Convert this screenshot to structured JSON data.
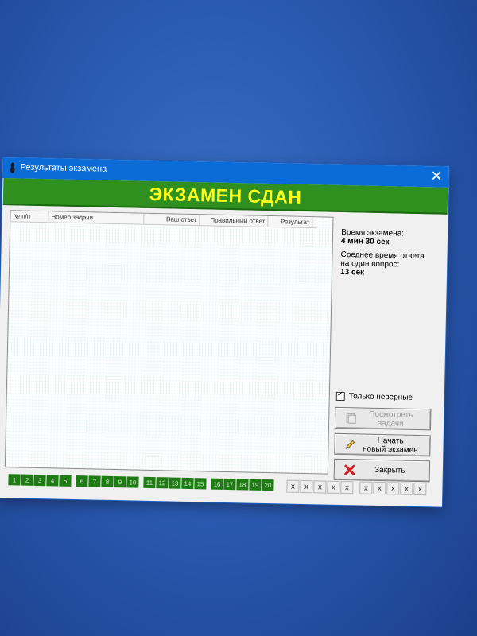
{
  "window": {
    "title": "Результаты экзамена"
  },
  "banner": {
    "text": "ЭКЗАМЕН СДАН"
  },
  "table": {
    "columns": [
      "№ п/п",
      "Номер задачи",
      "Ваш ответ",
      "Правильный ответ",
      "Результат"
    ]
  },
  "info": {
    "exam_time_label": "Время экзамена:",
    "exam_time_value": "4 мин 30 сек",
    "avg_label_line1": "Среднее время ответа",
    "avg_label_line2": "на один вопрос:",
    "avg_value": "13 сек"
  },
  "filter": {
    "only_wrong_label": "Только неверные",
    "checked": true
  },
  "buttons": {
    "view_tasks_line1": "Посмотреть",
    "view_tasks_line2": "задачи",
    "new_exam_line1": "Начать",
    "new_exam_line2": "новый экзамен",
    "close_label": "Закрыть"
  },
  "questions": [
    "1",
    "2",
    "3",
    "4",
    "5",
    "6",
    "7",
    "8",
    "9",
    "10",
    "11",
    "12",
    "13",
    "14",
    "15",
    "16",
    "17",
    "18",
    "19",
    "20"
  ],
  "extra_markers": [
    "x",
    "x",
    "x",
    "x",
    "x",
    "x",
    "x",
    "x",
    "x",
    "x"
  ],
  "colors": {
    "banner_bg": "#2f8f1f",
    "banner_text": "#fbff1a",
    "question_green": "#1f7c14",
    "titlebar": "#0b6cd8"
  },
  "icons": [
    "app-icon",
    "close-icon",
    "view-tasks-icon",
    "pencil-icon",
    "red-x-icon",
    "checkbox-check-icon"
  ]
}
